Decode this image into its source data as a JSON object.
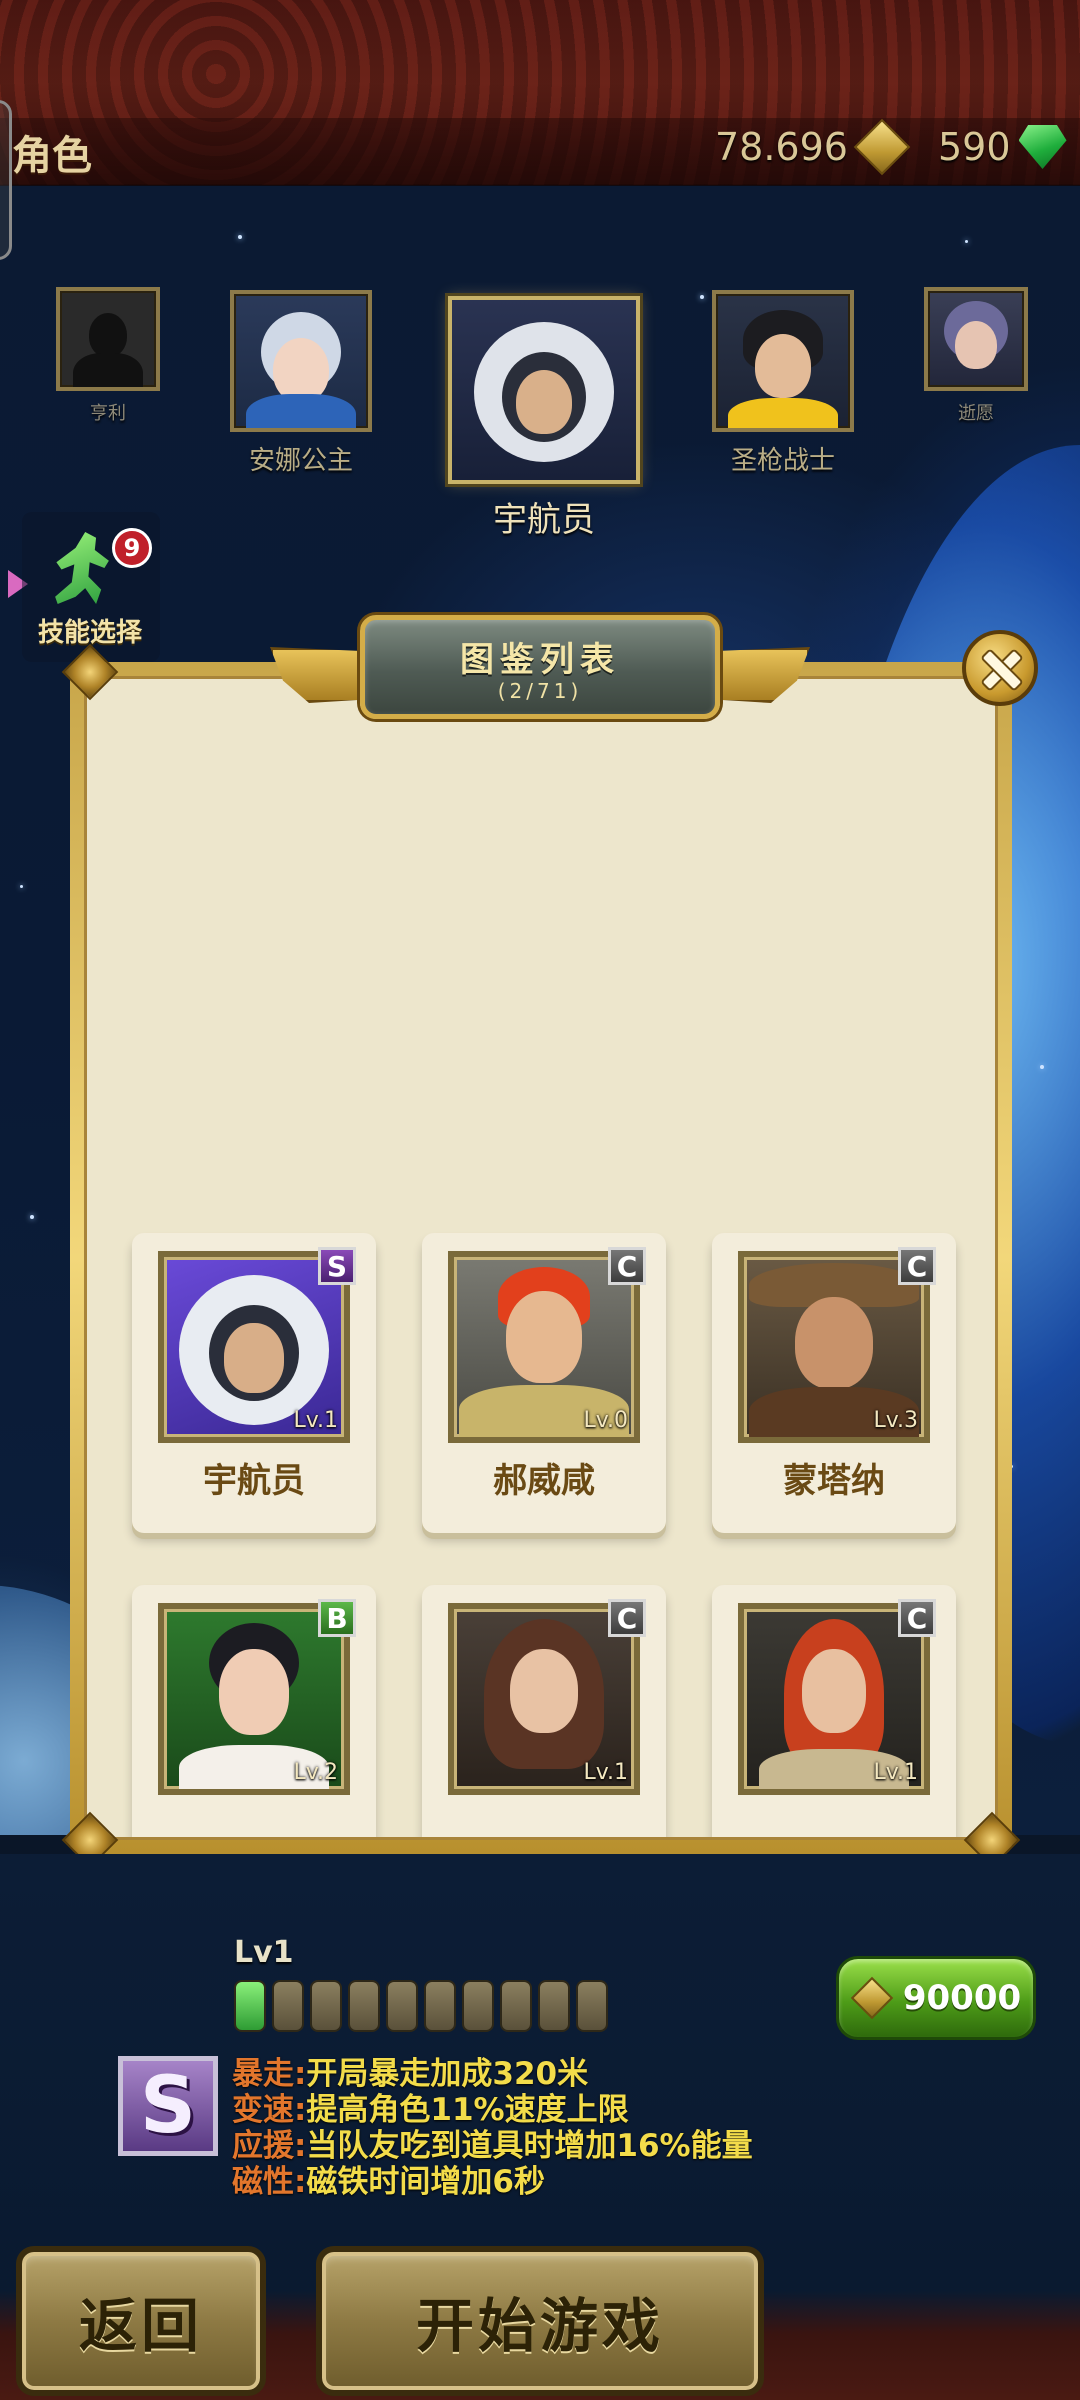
{
  "header": {
    "title": "角色",
    "gold_amount": "78.696",
    "gem_amount": "590"
  },
  "characters": [
    {
      "name": "亨利",
      "state": "locked"
    },
    {
      "name": "安娜公主",
      "state": "normal"
    },
    {
      "name": "宇航员",
      "state": "selected"
    },
    {
      "name": "圣枪战士",
      "state": "normal"
    },
    {
      "name": "逝愿",
      "state": "locked"
    }
  ],
  "skill_button": {
    "label": "技能选择",
    "badge": "9"
  },
  "panel": {
    "title": "图鉴列表",
    "subtitle": "(2/71)",
    "cards": [
      {
        "name": "宇航员",
        "grade": "S",
        "level": "Lv.1"
      },
      {
        "name": "郝威咸",
        "grade": "C",
        "level": "Lv.0"
      },
      {
        "name": "蒙塔纳",
        "grade": "C",
        "level": "Lv.3"
      },
      {
        "name": "",
        "grade": "B",
        "level": "Lv.2"
      },
      {
        "name": "",
        "grade": "C",
        "level": "Lv.1"
      },
      {
        "name": "",
        "grade": "C",
        "level": "Lv.1"
      }
    ]
  },
  "details": {
    "level": "Lv1",
    "level_pips_total": 10,
    "level_pips_filled": 1,
    "upgrade_price": "90000",
    "grade": "S",
    "skills": [
      {
        "key": "暴走:",
        "text": "开局暴走加成320米"
      },
      {
        "key": "变速:",
        "text": "提高角色11%速度上限"
      },
      {
        "key": "应援:",
        "text": "当队友吃到道具时增加16%能量"
      },
      {
        "key": "磁性:",
        "text": "磁铁时间增加6秒"
      }
    ]
  },
  "buttons": {
    "back": "返回",
    "start": "开始游戏"
  },
  "colors": {
    "gold": "#d4ad48",
    "gem": "#1fae3c",
    "skill_key": "#e2762c",
    "skill_text": "#f3dc4a"
  }
}
